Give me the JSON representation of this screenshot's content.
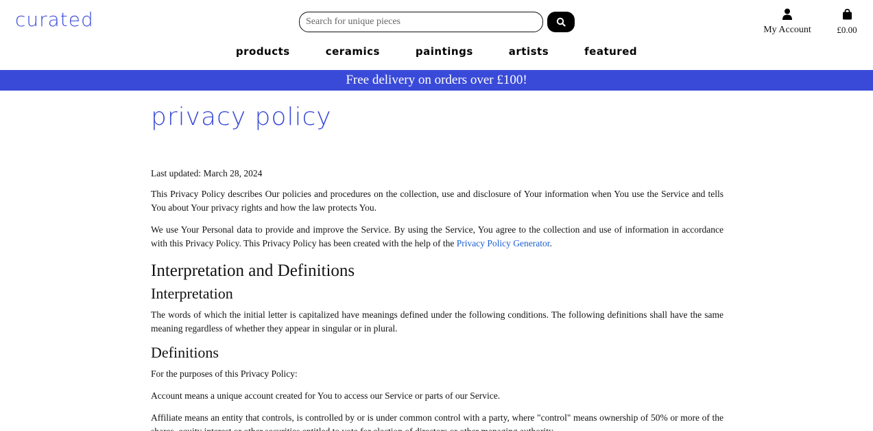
{
  "brand": {
    "logo": "curated",
    "accent": "#3a4ad8"
  },
  "search": {
    "placeholder": "Search for unique pieces",
    "value": ""
  },
  "header": {
    "account_label": "My Account",
    "cart_total": "£0.00"
  },
  "nav": {
    "items": [
      "products",
      "ceramics",
      "paintings",
      "artists",
      "featured"
    ]
  },
  "banner": {
    "text": "Free delivery on orders over £100!"
  },
  "page": {
    "title": "privacy policy",
    "last_updated": "Last updated: March 28, 2024",
    "intro1": "This Privacy Policy describes Our policies and procedures on the collection, use and disclosure of Your information when You use the Service and tells You about Your privacy rights and how the law protects You.",
    "intro2_prefix": "We use Your Personal data to provide and improve the Service. By using the Service, You agree to the collection and use of information in accordance with this Privacy Policy. This Privacy Policy has been created with the help of the ",
    "intro2_link": "Privacy Policy Generator",
    "intro2_suffix": ".",
    "section1": "Interpretation and Definitions",
    "sub_interpretation": "Interpretation",
    "interpretation_text": "The words of which the initial letter is capitalized have meanings defined under the following conditions. The following definitions shall have the same meaning regardless of whether they appear in singular or in plural.",
    "sub_definitions": "Definitions",
    "definitions_intro": "For the purposes of this Privacy Policy:",
    "def_account_term": "Account",
    "def_account_text": " means a unique account created for You to access our Service or parts of our Service.",
    "def_affiliate_term": "Affiliate",
    "def_affiliate_text": " means an entity that controls, is controlled by or is under common control with a party, where \"control\" means ownership of 50% or more of the shares, equity interest or other securities entitled to vote for election of directors or other managing authority."
  },
  "icons": {
    "search": "search-icon",
    "user": "user-icon",
    "cart": "shopping-bag-icon"
  }
}
